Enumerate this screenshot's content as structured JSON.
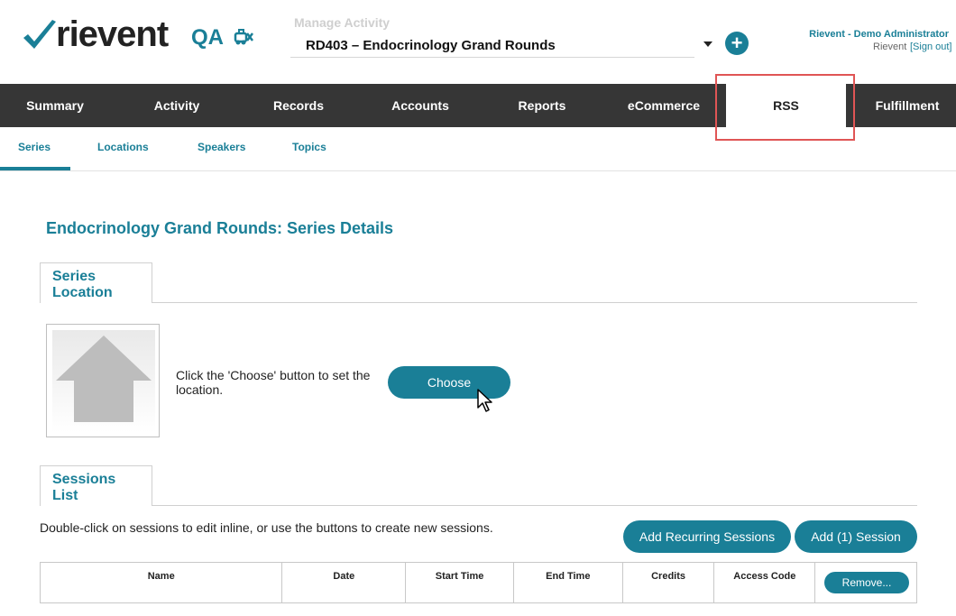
{
  "header": {
    "logo_text": "rievent",
    "environment": "QA",
    "manage_label": "Manage Activity",
    "activity_selected": "RD403 – Endocrinology Grand Rounds",
    "add_icon": "plus-icon",
    "user_name": "Rievent - Demo Administrator",
    "user_org": "Rievent",
    "signout_label": "[Sign out]"
  },
  "main_nav": {
    "items": [
      {
        "label": "Summary"
      },
      {
        "label": "Activity"
      },
      {
        "label": "Records"
      },
      {
        "label": "Accounts"
      },
      {
        "label": "Reports"
      },
      {
        "label": "eCommerce"
      },
      {
        "label": "RSS",
        "active": true
      },
      {
        "label": "Fulfillment"
      }
    ]
  },
  "sub_nav": {
    "items": [
      {
        "label": "Series",
        "active": true
      },
      {
        "label": "Locations"
      },
      {
        "label": "Speakers"
      },
      {
        "label": "Topics"
      }
    ]
  },
  "page": {
    "title": "Endocrinology Grand Rounds: Series Details",
    "location_tab": "Series Location",
    "location_hint": "Click the 'Choose' button to set the location.",
    "choose_label": "Choose",
    "sessions_tab": "Sessions List",
    "sessions_help": "Double-click on sessions to edit inline, or use the buttons to create new sessions.",
    "add_recurring_label": "Add Recurring Sessions",
    "add_session_label": "Add (1) Session"
  },
  "sessions_table": {
    "columns": [
      "Name",
      "Date",
      "Start Time",
      "End Time",
      "Credits",
      "Access Code"
    ],
    "remove_label": "Remove..."
  },
  "colors": {
    "accent": "#1a7f97",
    "nav_bg": "#363636",
    "highlight": "#e05555"
  }
}
